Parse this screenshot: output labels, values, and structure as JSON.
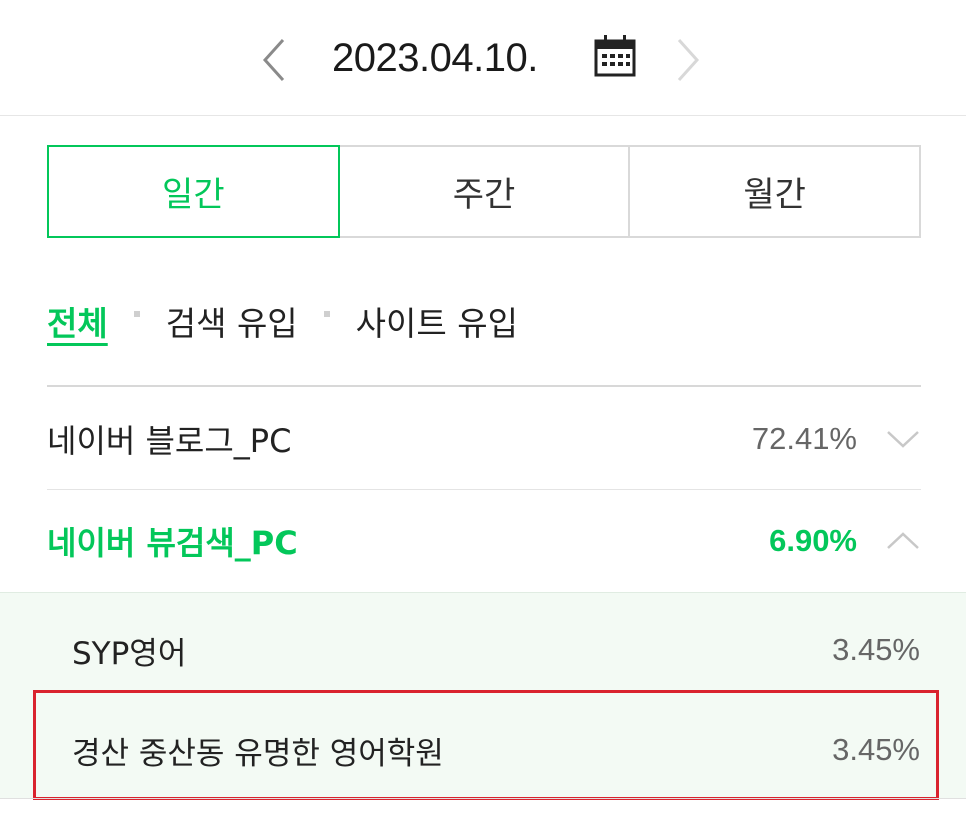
{
  "date_nav": {
    "date": "2023.04.10.",
    "prev_icon": "chevron-left-icon",
    "next_icon": "chevron-right-icon",
    "calendar_icon": "calendar-icon"
  },
  "period_tabs": [
    {
      "label": "일간",
      "active": true
    },
    {
      "label": "주간",
      "active": false
    },
    {
      "label": "월간",
      "active": false
    }
  ],
  "filters": [
    {
      "label": "전체",
      "active": true
    },
    {
      "label": "검색 유입",
      "active": false
    },
    {
      "label": "사이트 유입",
      "active": false
    }
  ],
  "sources": [
    {
      "name": "네이버 블로그_PC",
      "percent": "72.41%",
      "expanded": false
    },
    {
      "name": "네이버 뷰검색_PC",
      "percent": "6.90%",
      "expanded": true
    }
  ],
  "keywords": [
    {
      "name": "SYP영어",
      "percent": "3.45%"
    },
    {
      "name": "경산 중산동 유명한 영어학원",
      "percent": "3.45%",
      "highlighted": true
    }
  ],
  "colors": {
    "accent": "#03c75a",
    "highlight_border": "#d9232e",
    "subpanel_bg": "#f3faf4"
  }
}
